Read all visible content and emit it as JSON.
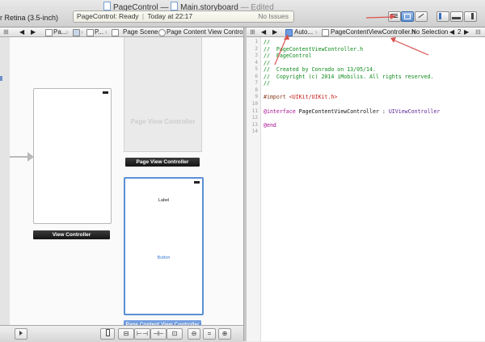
{
  "window": {
    "title_project": "PageControl",
    "title_dash": "—",
    "title_file": "Main.storyboard",
    "title_state": "— Edited",
    "device_label": "r Retina (3.5-inch)"
  },
  "activity": {
    "status": "PageControl: Ready",
    "separator": "|",
    "time": "Today at 22:17",
    "issues": "No Issues"
  },
  "left_jumpbar": {
    "back": "◀",
    "forward": "▶",
    "item1": "Pa...",
    "item2": "P...",
    "item3": "Page Scene",
    "item4": "Page Content View Controller"
  },
  "right_jumpbar": {
    "back": "◀",
    "forward": "▶",
    "automatic": "Auto...",
    "file": "PageContentViewController.h",
    "selection": "No Selection",
    "counter": "2",
    "counter_prev": "◀",
    "counter_next": "▶"
  },
  "canvas": {
    "page_view_controller_title": "Page View Controller",
    "page_view_controller_dock": "Page View Controller",
    "view_controller_dock": "View Controller",
    "page_content_label": "Label",
    "page_content_button": "Button",
    "page_content_dock": "Page Content View Controller"
  },
  "editor": {
    "line_numbers": [
      "1",
      "2",
      "3",
      "4",
      "5",
      "6",
      "7",
      "8",
      "9",
      "10",
      "11",
      "12",
      "13",
      "14"
    ],
    "lines": [
      [
        {
          "t": "//",
          "c": "comment"
        }
      ],
      [
        {
          "t": "//  PageContentViewController.h",
          "c": "comment"
        }
      ],
      [
        {
          "t": "//  PageControl",
          "c": "comment"
        }
      ],
      [
        {
          "t": "//",
          "c": "comment"
        }
      ],
      [
        {
          "t": "//  Created by Conrado on 13/05/14.",
          "c": "comment"
        }
      ],
      [
        {
          "t": "//  Copyright (c) 2014 iMobilis. All rights reserved.",
          "c": "comment"
        }
      ],
      [
        {
          "t": "//",
          "c": "comment"
        }
      ],
      [],
      [
        {
          "t": "#import ",
          "c": "directive"
        },
        {
          "t": "<UIKit/UIKit.h>",
          "c": "string"
        }
      ],
      [],
      [
        {
          "t": "@interface",
          "c": "keyword"
        },
        {
          "t": " PageContentViewController : ",
          "c": "plain"
        },
        {
          "t": "UIViewController",
          "c": "type"
        }
      ],
      [],
      [
        {
          "t": "@end",
          "c": "keyword"
        }
      ],
      []
    ]
  },
  "bottom_bar": {
    "zoom_out": "−",
    "zoom_fit": "=",
    "zoom_in": "+"
  },
  "colors": {
    "accent": "#5b8fd6",
    "annotation_arrow": "#d9534f",
    "comment": "#0f8a1c",
    "keyword": "#aa0d91"
  }
}
